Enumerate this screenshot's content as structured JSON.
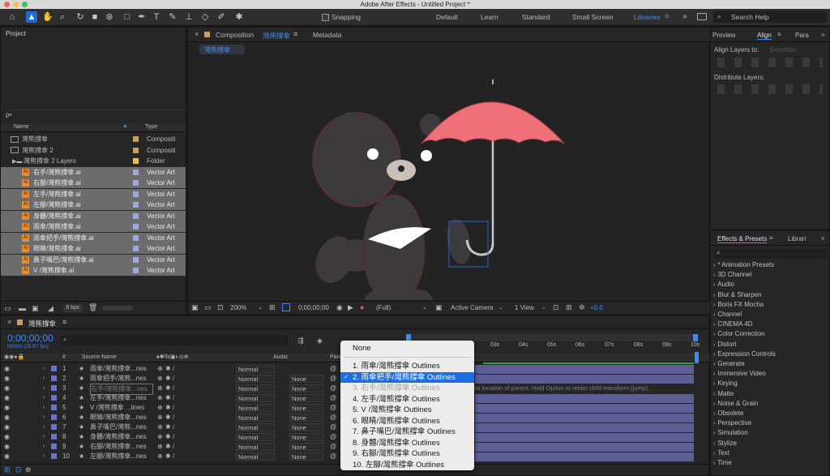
{
  "window_title": "Adobe After Effects - Untitled Project *",
  "toolbar": {
    "snapping_label": "Snapping",
    "workspaces": [
      "Default",
      "Learn",
      "Standard",
      "Small Screen",
      "Libraries"
    ],
    "search_placeholder": "Search Help"
  },
  "project": {
    "title": "Project",
    "search_prefix": "ρ•",
    "col_name": "Name",
    "col_type": "Type",
    "items": [
      {
        "name": "灣熊撐傘",
        "type": "Compositi",
        "color": "#c4a162",
        "kind": "comp"
      },
      {
        "name": "灣熊撐傘 2",
        "type": "Compositi",
        "color": "#c4a162",
        "kind": "comp"
      },
      {
        "name": "灣熊撐傘 2 Layers",
        "type": "Folder",
        "color": "#e0c54b",
        "kind": "folder"
      },
      {
        "name": "右手/灣熊撐傘.ai",
        "type": "Vector Art",
        "color": "#a3a7d8",
        "kind": "ai"
      },
      {
        "name": "右腳/灣熊撐傘.ai",
        "type": "Vector Art",
        "color": "#a3a7d8",
        "kind": "ai"
      },
      {
        "name": "左手/灣熊撐傘.ai",
        "type": "Vector Art",
        "color": "#a3a7d8",
        "kind": "ai"
      },
      {
        "name": "左腳/灣熊撐傘.ai",
        "type": "Vector Art",
        "color": "#a3a7d8",
        "kind": "ai"
      },
      {
        "name": "身體/灣熊撐傘.ai",
        "type": "Vector Art",
        "color": "#a3a7d8",
        "kind": "ai"
      },
      {
        "name": "雨傘/灣熊撐傘.ai",
        "type": "Vector Art",
        "color": "#a3a7d8",
        "kind": "ai"
      },
      {
        "name": "雨傘把手/灣熊撐傘.ai",
        "type": "Vector Art",
        "color": "#a3a7d8",
        "kind": "ai"
      },
      {
        "name": "眼睛/灣熊撐傘.ai",
        "type": "Vector Art",
        "color": "#a3a7d8",
        "kind": "ai"
      },
      {
        "name": "鼻子嘴巴/灣熊撐傘.ai",
        "type": "Vector Art",
        "color": "#a3a7d8",
        "kind": "ai"
      },
      {
        "name": "V /灣熊撐傘.ai",
        "type": "Vector Art",
        "color": "#a3a7d8",
        "kind": "ai"
      }
    ],
    "bpc": "8 bpc"
  },
  "composition": {
    "tab_label": "Composition",
    "tab_name": "灣熊撐傘",
    "metadata_tab": "Metadata",
    "breadcrumb": "灣熊撐傘",
    "zoom": "200%",
    "timecode": "0;00;00;00",
    "resolution": "(Full)",
    "camera": "Active Camera",
    "view": "1 View",
    "exposure": "+0.0"
  },
  "right_panel": {
    "tabs": [
      "Preview",
      "Align",
      "Para"
    ],
    "align_layers_to": "Align Layers to:",
    "align_selection": "Selection",
    "distribute_layers": "Distribute Layers:",
    "effects_tab": "Effects & Presets",
    "libraries_tab": "Librari",
    "effects": [
      "* Animation Presets",
      "3D Channel",
      "Audio",
      "Blur & Sharpen",
      "Boris FX Mocha",
      "Channel",
      "CINEMA 4D",
      "Color Correction",
      "Distort",
      "Expression Controls",
      "Generate",
      "Immersive Video",
      "Keying",
      "Matte",
      "Noise & Grain",
      "Obsolete",
      "Perspective",
      "Simulation",
      "Stylize",
      "Text",
      "Time"
    ]
  },
  "timeline": {
    "tab_name": "灣熊撐傘",
    "timecode": "0;00;00;00",
    "fps": "00000 (29.97 fps)",
    "col_hash": "#",
    "col_source": "Source Name",
    "col_audio": "Audio",
    "col_parent": "Pare",
    "ruler": [
      "03s",
      "04s",
      "05s",
      "06s",
      "07s",
      "08s",
      "09s",
      "10s"
    ],
    "hint_text": "to location of parent. Hold Option to retain child transform (jump).",
    "layers": [
      {
        "num": "1",
        "name": "雨傘/灣熊撐傘...nes",
        "mode": "Normal",
        "parent": "",
        "color": "#6a6fd6"
      },
      {
        "num": "2",
        "name": "雨傘把手/灣熊...nes",
        "mode": "Normal",
        "parent": "None",
        "color": "#6a6fd6"
      },
      {
        "num": "3",
        "name": "右手/灣熊撐傘...nes",
        "mode": "Normal",
        "parent": "None",
        "color": "#6a6fd6"
      },
      {
        "num": "4",
        "name": "左手/灣熊撐傘...nes",
        "mode": "Normal",
        "parent": "None",
        "color": "#6a6fd6"
      },
      {
        "num": "5",
        "name": "V /灣熊撐傘 ...lines",
        "mode": "Normal",
        "parent": "None",
        "color": "#6a6fd6"
      },
      {
        "num": "6",
        "name": "眼睛/灣熊撐傘...nes",
        "mode": "Normal",
        "parent": "None",
        "color": "#6a6fd6"
      },
      {
        "num": "7",
        "name": "鼻子嘴巴/灣熊...nes",
        "mode": "Normal",
        "parent": "None",
        "color": "#6a6fd6"
      },
      {
        "num": "8",
        "name": "身體/灣熊撐傘...nes",
        "mode": "Normal",
        "parent": "None",
        "color": "#6a6fd6"
      },
      {
        "num": "9",
        "name": "右腳/灣熊撐傘...nes",
        "mode": "Normal",
        "parent": "None",
        "color": "#6a6fd6"
      },
      {
        "num": "10",
        "name": "左腳/灣熊撐傘...nes",
        "mode": "Normal",
        "parent": "None",
        "color": "#6a6fd6"
      }
    ]
  },
  "parent_menu": {
    "items": [
      {
        "label": "None",
        "state": "normal"
      },
      {
        "label": "1. 雨傘/灣熊撐傘 Outlines",
        "state": "normal"
      },
      {
        "label": "2. 雨傘把手/灣熊撐傘 Outlines",
        "state": "highlighted"
      },
      {
        "label": "3. 右手/灣熊撐傘 Outlines",
        "state": "disabled"
      },
      {
        "label": "4. 左手/灣熊撐傘 Outlines",
        "state": "normal"
      },
      {
        "label": "5. V /灣熊撐傘 Outlines",
        "state": "normal"
      },
      {
        "label": "6. 眼睛/灣熊撐傘 Outlines",
        "state": "normal"
      },
      {
        "label": "7. 鼻子嘴巴/灣熊撐傘 Outlines",
        "state": "normal"
      },
      {
        "label": "8. 身體/灣熊撐傘 Outlines",
        "state": "normal"
      },
      {
        "label": "9. 右腳/灣熊撐傘 Outlines",
        "state": "normal"
      },
      {
        "label": "10. 左腳/灣熊撐傘 Outlines",
        "state": "normal"
      }
    ]
  }
}
